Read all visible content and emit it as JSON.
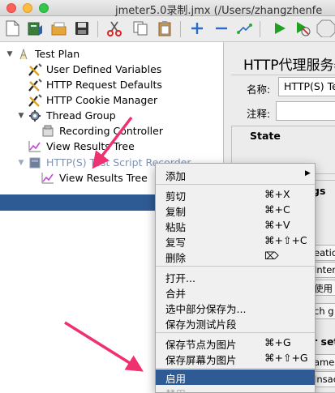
{
  "window": {
    "title": "jmeter5.0录制.jmx (/Users/zhangzhenfe"
  },
  "toolbar": {
    "icons": [
      "new-icon",
      "templates-icon",
      "open-icon",
      "save-icon",
      "cut-icon",
      "copy-icon",
      "paste-icon",
      "expand-icon",
      "collapse-icon",
      "toggle-icon",
      "start-icon",
      "start-no-pause-icon",
      "stop-icon"
    ]
  },
  "tree": {
    "items": [
      {
        "label": "Test Plan",
        "icon": "test-plan-icon"
      },
      {
        "label": "User Defined Variables",
        "icon": "wrench-icon"
      },
      {
        "label": "HTTP Request Defaults",
        "icon": "wrench-icon"
      },
      {
        "label": "HTTP Cookie Manager",
        "icon": "wrench-icon"
      },
      {
        "label": "Thread Group",
        "icon": "gear-icon"
      },
      {
        "label": "Recording Controller",
        "icon": "controller-icon"
      },
      {
        "label": "View Results Tree",
        "icon": "chart-icon"
      },
      {
        "label": "HTTP(S) Test Script Recorder",
        "icon": "recorder-icon"
      },
      {
        "label": "View Results Tree",
        "icon": "chart-icon"
      }
    ]
  },
  "right_panel": {
    "title": "HTTP代理服务器",
    "name_label": "名称:",
    "name_value": "HTTP(S) Te",
    "comment_label": "注释:",
    "state_label": "State",
    "fragments": [
      "gs",
      "eatio",
      "Inten",
      "使用",
      "ch g",
      "r set",
      "ame",
      "Insac"
    ]
  },
  "context_menu": {
    "items": [
      {
        "label": "添加",
        "shortcut": "",
        "submenu": true
      },
      {
        "label": "剪切",
        "shortcut": "⌘+X"
      },
      {
        "label": "复制",
        "shortcut": "⌘+C"
      },
      {
        "label": "粘贴",
        "shortcut": "⌘+V"
      },
      {
        "label": "复写",
        "shortcut": "⌘+⇧+C"
      },
      {
        "label": "删除",
        "shortcut": "⌦"
      },
      {
        "label": "打开...",
        "shortcut": ""
      },
      {
        "label": "合并",
        "shortcut": ""
      },
      {
        "label": "选中部分保存为...",
        "shortcut": ""
      },
      {
        "label": "保存为测试片段",
        "shortcut": ""
      },
      {
        "label": "保存节点为图片",
        "shortcut": "⌘+G"
      },
      {
        "label": "保存屏幕为图片",
        "shortcut": "⌘+⇧+G"
      },
      {
        "label": "启用",
        "shortcut": ""
      },
      {
        "label": "禁用",
        "shortcut": ""
      }
    ]
  },
  "colors": {
    "selection": "#2f5b95",
    "annotation_arrow": "#f0316f"
  }
}
